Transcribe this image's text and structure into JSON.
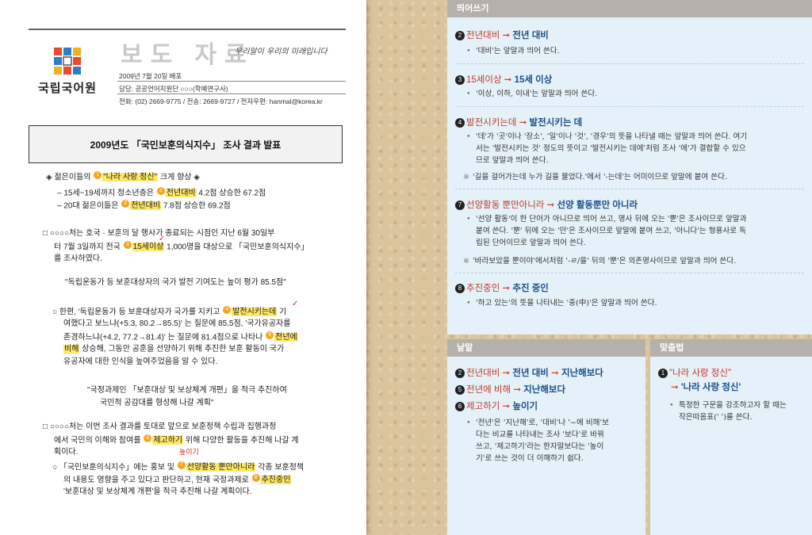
{
  "left": {
    "org_name": "국립국어원",
    "press_label": "보도 자료",
    "slogan": "우리말이 우리의 미래입니다",
    "date": "2009년 7월 20일 배포",
    "contact": "담당: 공공언어지원단 ○○○(학예연구사)",
    "phone": "전화: (02) 2669-9775 / 전송: 2669-9727 / 전자우편: hanmal@korea.kr",
    "title": "2009년도 「국민보훈의식지수」 조사 결과 발표",
    "lines": [
      {
        "a": "◈ 젊은이들의 ",
        "n": "1",
        "h": "\"나라 사랑 정신\"",
        "b": " 크게 향상 ◈"
      },
      {
        "a": "– 15세~19세까지 청소년층은 ",
        "n": "2",
        "h": "전년대비",
        "b": " 4.2점 상승한 67.2점"
      },
      {
        "a": "– 20대 젊은이들은 ",
        "n": "2",
        "h": "전년대비",
        "b": " 7.8점 상승한 69.2점"
      },
      {
        "a": "□ ○○○○처는 호국 · 보훈의 달 행사가 종료되는 시점인 지난 6월 30일부",
        "n": "",
        "h": "",
        "b": ""
      },
      {
        "a": "터 7월 3일까지 전국 ",
        "n": "3",
        "h": "15세이상",
        "b": " 1,000명을 대상으로 「국민보훈의식지수」"
      },
      {
        "a": "를 조사하였다.",
        "n": "",
        "h": "",
        "b": ""
      },
      {
        "a": "\"독립운동가 등 보훈대상자의 국가 발전 기여도는 높이 평가 85.5점\"",
        "n": "",
        "h": "",
        "b": ""
      },
      {
        "a": "○ 한편, '독립운동가 등 보훈대상자가 국가를 지키고 ",
        "n": "4",
        "h": "발전시키는데",
        "b": " 기"
      },
      {
        "a": "여했다고 보느냐(+5.3, 80.2→85.5)' 는 질문에 85.5점, '국가유공자를",
        "n": "",
        "h": "",
        "b": ""
      },
      {
        "a": "존경하느냐(+4.2, 77.2→81.4)' 는 질문에 81.4점으로 나타나 ",
        "n": "5",
        "h": "전년에",
        "b": ""
      },
      {
        "a": "",
        "n": "",
        "h": "비해",
        "b": " 상승해, 그동안 공훈을 선양하기 위해 추진한 보훈 활동이 국가"
      },
      {
        "a": "유공자에 대한 인식을 높여주었음을 알 수 있다.",
        "n": "",
        "h": "",
        "b": ""
      },
      {
        "a": "\"국정과제인 「보훈대상 및 보상체계 개편」을 적극 추진하여",
        "n": "",
        "h": "",
        "b": ""
      },
      {
        "a": "국민적 공감대를 형성해 나갈 계획\"",
        "n": "",
        "h": "",
        "b": ""
      },
      {
        "a": "□ ○○○○처는 이번 조사 결과를 토대로 앞으로 보훈정책 수립과 집행과정",
        "n": "",
        "h": "",
        "b": ""
      },
      {
        "a": "에서 국민의 이해와 참여를 ",
        "n": "6",
        "h": "제고하기",
        "b": " 위해 다양한 활동을 추진해 나갈 계"
      },
      {
        "a": "획이다.",
        "n": "",
        "h": "",
        "b": ""
      },
      {
        "a": "○ 「국민보훈의식지수」에는 홍보 및 ",
        "n": "7",
        "h": "선양활동 뿐만아니라",
        "b": " 각종 보훈정책"
      },
      {
        "a": "의 내용도 영향을 주고 있다고 판단하고, 현재 국정과제로 ",
        "n": "8",
        "h": "추진중인",
        "b": ""
      },
      {
        "a": "'보훈대상 및 보상체계 개편'을 적극 추진해 나갈 계획이다.",
        "n": "",
        "h": "",
        "b": ""
      }
    ],
    "red_note": "높이기"
  },
  "right": {
    "spacing": {
      "head": "띄어쓰기",
      "entries": [
        {
          "no": "2",
          "old": "전년대비",
          "new": "전년 대비",
          "desc": "'대비'는 앞말과 띄어 쓴다."
        },
        {
          "no": "3",
          "old": "15세이상",
          "new": "15세 이상",
          "desc": "'이상, 이하, 이내'는 앞말과 띄어 쓴다."
        },
        {
          "no": "4",
          "old": "발전시키는데",
          "new": "발전시키는 데",
          "desc1": "'데'가 '곳'이나 '장소', '일'이나 '것', '경우'의 뜻을 나타낼 때는 앞말과 띄어 쓴다. 여기",
          "desc2": "서는 '발전시키는 것' 정도의 뜻이고 '발전시키는 데에'처럼 조사 '에'가 결합할 수 있으",
          "desc3": "므로 앞말과 띄어 쓴다.",
          "note": "'길을 걸어가는데 누가 길을 물었다.'에서 '-는데'는 어미이므로 앞말에 붙여 쓴다."
        },
        {
          "no": "7",
          "old": "선양활동 뿐만아니라",
          "new": "선양 활동뿐만 아니라",
          "desc1": "'선양 활동'이 한 단어가 아니므로 띄어 쓰고, 명사 뒤에 오는 '뿐'은 조사이므로 앞말과",
          "desc2": "붙여 쓴다. '뿐' 뒤에 오는 '만'은 조사이므로 앞말에 붙여 쓰고, '아니다'는 형용사로 독",
          "desc3": "립된 단어이므로 앞말과 띄어 쓴다.",
          "note": "'바라보았을 뿐이야'에서처럼 '-ㄹ/을' 뒤의 '뿐'은 의존명사이므로 앞말과 띄어 쓴다."
        },
        {
          "no": "8",
          "old": "추진중인",
          "new": "추진 중인",
          "desc": "'하고 있는'의 뜻을 나타내는 '중(中)'은 앞말과 띄어 쓴다."
        }
      ]
    },
    "words": {
      "head": "낱말",
      "entries": [
        {
          "no": "2",
          "old": "전년대비",
          "mid": "전년 대비",
          "new": "지난해보다"
        },
        {
          "no": "5",
          "old": "전년에 비해",
          "new": "지난해보다"
        },
        {
          "no": "6",
          "old": "제고하기",
          "new": "높이기"
        }
      ],
      "desc1": "'전년'은 '지난해'로, '대비'나 '~에 비해'보",
      "desc2": "다는 비교를 나타내는 조사 '보다'로 바꿔",
      "desc3": "쓰고, '제고하기'라는 한자말보다는 '높이",
      "desc4": "기'로 쓰는 것이 더 이해하기 쉽다."
    },
    "punct": {
      "head": "맞춤법",
      "no": "1",
      "old": "\"나라 사랑 정신\"",
      "new": "'나라 사랑 정신'",
      "desc1": "특정한 구문을 강조하고자 할 때는",
      "desc2": "작은따옴표(' ')를 쓴다."
    }
  }
}
